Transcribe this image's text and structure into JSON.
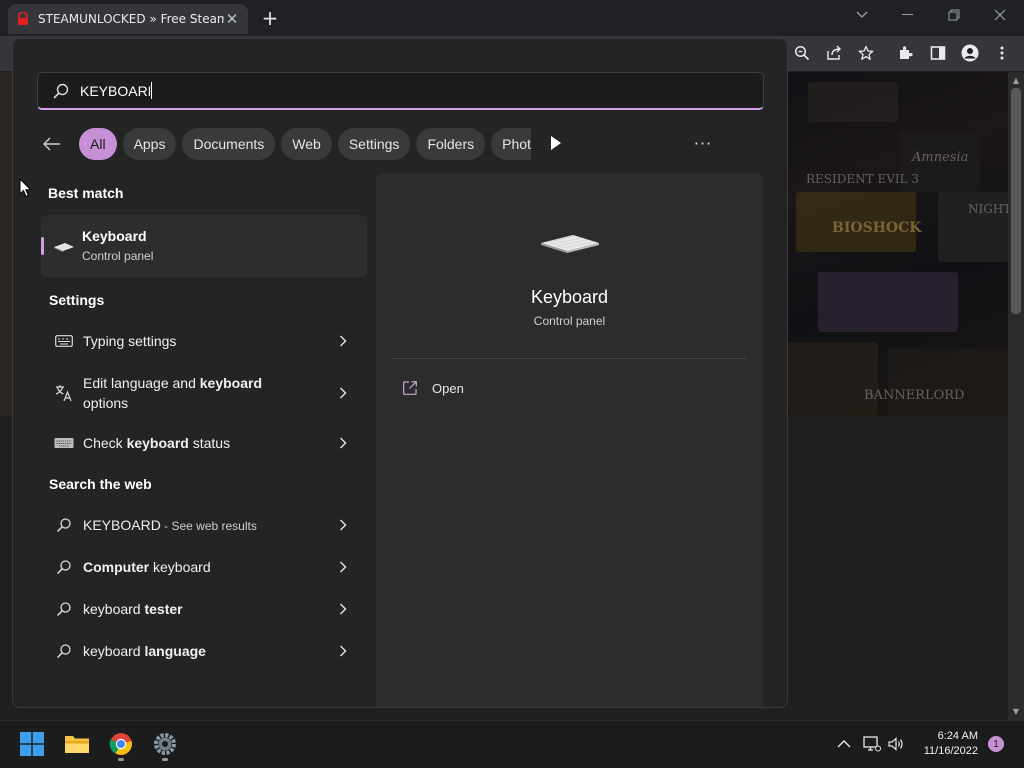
{
  "browser": {
    "tab_title": "STEAMUNLOCKED » Free Steam Games Pre-installed for PC",
    "window_controls": {
      "tab_search": "chevron-down-icon",
      "minimize": "minimize-icon",
      "maximize": "restore-icon",
      "close": "close-icon"
    },
    "toolbar_icons": [
      "zoom-icon",
      "share-icon",
      "star-icon",
      "extensions-icon",
      "side-panel-icon",
      "profile-icon",
      "menu-icon"
    ],
    "page_art_labels": {
      "resident": "RESIDENT EVIL 3",
      "amnesia": "Amnesia",
      "bioshock": "BIOSHOCK",
      "bannerlord": "BANNERLORD",
      "night": "NIGHT"
    }
  },
  "search": {
    "query": "KEYBOARD",
    "filters": [
      {
        "label": "All",
        "active": true
      },
      {
        "label": "Apps",
        "active": false
      },
      {
        "label": "Documents",
        "active": false
      },
      {
        "label": "Web",
        "active": false
      },
      {
        "label": "Settings",
        "active": false
      },
      {
        "label": "Folders",
        "active": false
      },
      {
        "label": "Photos",
        "active": false
      }
    ],
    "more_label": "···"
  },
  "results": {
    "best_match": {
      "heading": "Best match",
      "title": "Keyboard",
      "subtitle": "Control panel"
    },
    "settings": {
      "heading": "Settings",
      "items": [
        {
          "pre": "Typing settings",
          "bold": "",
          "post": "",
          "line2": ""
        },
        {
          "pre": "Edit language and ",
          "bold": "keyboard",
          "post": "",
          "line2": "options"
        },
        {
          "pre": "Check ",
          "bold": "keyboard",
          "post": " status",
          "line2": ""
        }
      ]
    },
    "web": {
      "heading": "Search the web",
      "items": [
        {
          "pre": "KEYBOARD",
          "bold": "",
          "post": "",
          "suffix": " - See web results"
        },
        {
          "pre": "",
          "bold": "Computer",
          "post": " keyboard",
          "suffix": ""
        },
        {
          "pre": "keyboard ",
          "bold": "tester",
          "post": "",
          "suffix": ""
        },
        {
          "pre": "keyboard ",
          "bold": "language",
          "post": "",
          "suffix": ""
        }
      ]
    }
  },
  "preview": {
    "title": "Keyboard",
    "subtitle": "Control panel",
    "actions": [
      {
        "label": "Open",
        "icon": "open-external-icon"
      }
    ]
  },
  "taskbar": {
    "apps": [
      "windows-start-icon",
      "file-explorer-icon",
      "chrome-icon",
      "settings-gear-icon"
    ],
    "time": "6:24 AM",
    "date": "11/16/2022",
    "notification_count": "1"
  },
  "colors": {
    "accent": "#c68fd6",
    "flyout_bg": "#242424",
    "card_bg": "#2d2d2d",
    "taskbar_bg": "#1c1c1c"
  }
}
